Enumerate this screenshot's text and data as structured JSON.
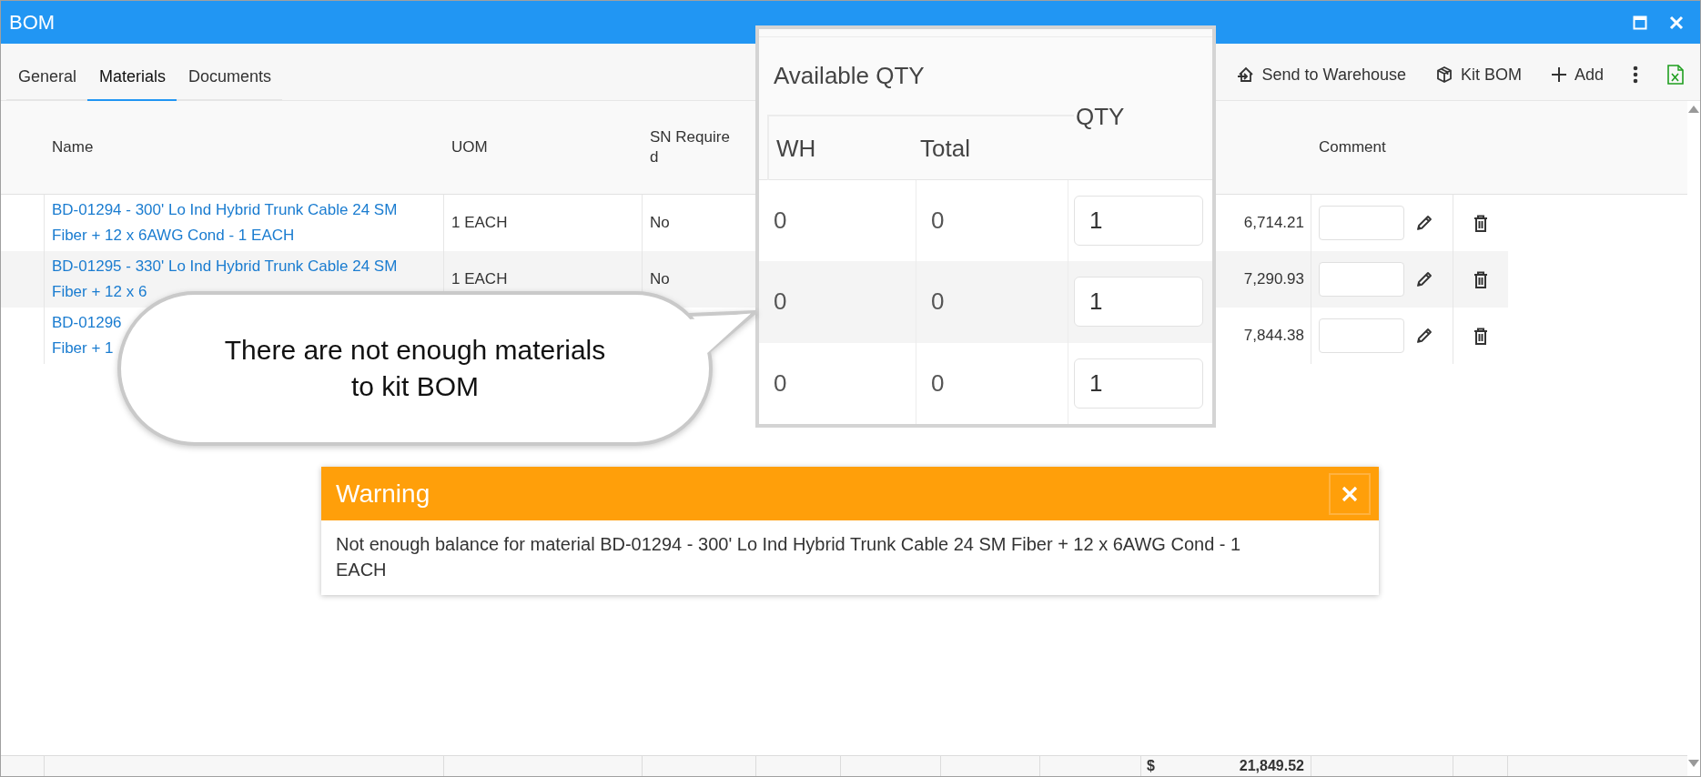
{
  "window": {
    "title": "BOM"
  },
  "tabs": [
    {
      "label": "General",
      "selected": false
    },
    {
      "label": "Materials",
      "selected": true
    },
    {
      "label": "Documents",
      "selected": false
    }
  ],
  "toolbar": [
    {
      "kind": "send",
      "label": "Send to Warehouse"
    },
    {
      "kind": "kit",
      "label": "Kit BOM"
    },
    {
      "kind": "add",
      "label": "Add"
    },
    {
      "kind": "more"
    },
    {
      "kind": "excel"
    }
  ],
  "table": {
    "headers": {
      "name": "Name",
      "uom": "UOM",
      "sn_required": "SN Required",
      "comment": "Comment"
    },
    "rows": [
      {
        "name_lines": [
          "BD-01294 - 300' Lo Ind Hybrid Trunk Cable 24 SM",
          "Fiber + 12 x 6AWG Cond - 1 EACH"
        ],
        "uom": "1 EACH",
        "sn_required": "No",
        "column_9": "6,714.21"
      },
      {
        "name_lines": [
          "BD-01295 - 330' Lo Ind Hybrid Trunk Cable 24 SM",
          "Fiber + 12 x 6"
        ],
        "uom": "1 EACH",
        "sn_required": "No",
        "column_9": "7,290.93"
      },
      {
        "name_lines": [
          "BD-01296",
          "Fiber + 1"
        ],
        "column_9": "7,844.38"
      }
    ],
    "footer": {
      "currency": "$",
      "total": "21,849.52"
    }
  },
  "available_qty_inset": {
    "group_header": "Available QTY",
    "columns": {
      "wh": "WH",
      "total": "Total",
      "qty": "QTY"
    },
    "rows": [
      {
        "wh": "0",
        "total": "0",
        "qty": "1"
      },
      {
        "wh": "0",
        "total": "0",
        "qty": "1"
      },
      {
        "wh": "0",
        "total": "0",
        "qty": "1"
      }
    ]
  },
  "callout": {
    "text": "There are not enough materials to kit BOM"
  },
  "warning": {
    "title": "Warning",
    "message": "Not enough balance for material BD-01294 - 300' Lo Ind Hybrid Trunk Cable 24 SM Fiber + 12 x 6AWG Cond - 1 EACH"
  }
}
